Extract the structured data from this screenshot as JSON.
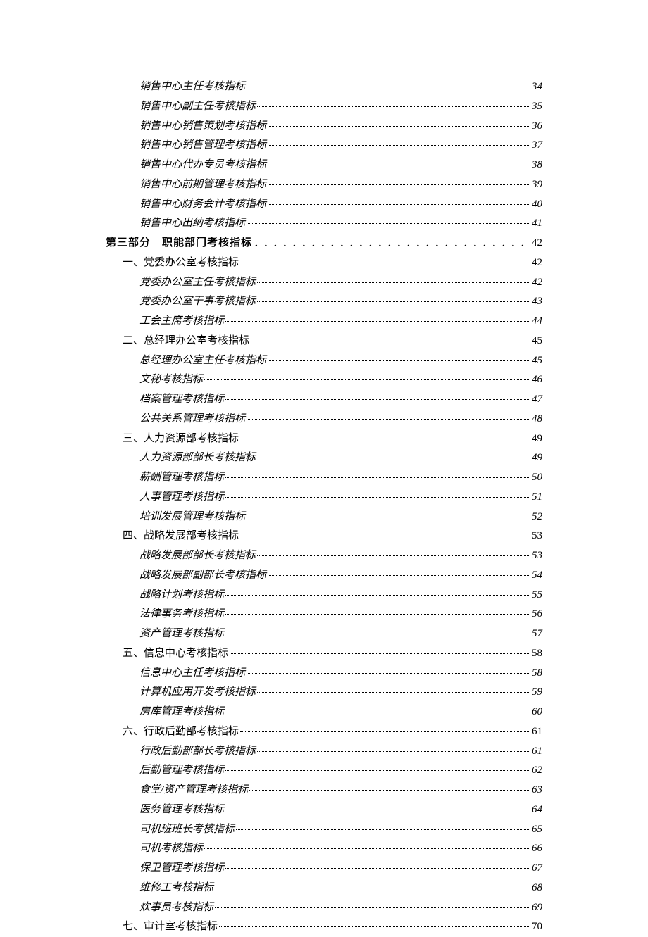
{
  "toc": [
    {
      "level": 4,
      "label": "销售中心主任考核指标",
      "page": "34"
    },
    {
      "level": 4,
      "label": "销售中心副主任考核指标",
      "page": "35"
    },
    {
      "level": 4,
      "label": "销售中心销售策划考核指标",
      "page": "36"
    },
    {
      "level": 4,
      "label": "销售中心销售管理考核指标",
      "page": "37"
    },
    {
      "level": 4,
      "label": "销售中心代办专员考核指标",
      "page": "38"
    },
    {
      "level": 4,
      "label": "销售中心前期管理考核指标",
      "page": "39"
    },
    {
      "level": 4,
      "label": "销售中心财务会计考核指标",
      "page": "40"
    },
    {
      "level": 4,
      "label": "销售中心出纳考核指标",
      "page": "41"
    },
    {
      "level": 2,
      "label": "第三部分　职能部门考核指标",
      "page": "42"
    },
    {
      "level": 3,
      "label": "一、党委办公室考核指标",
      "page": "42"
    },
    {
      "level": 4,
      "label": "党委办公室主任考核指标",
      "page": "42"
    },
    {
      "level": 4,
      "label": "党委办公室干事考核指标",
      "page": "43"
    },
    {
      "level": 4,
      "label": "工会主席考核指标",
      "page": "44"
    },
    {
      "level": 3,
      "label": "二、总经理办公室考核指标",
      "page": "45"
    },
    {
      "level": 4,
      "label": "总经理办公室主任考核指标",
      "page": "45"
    },
    {
      "level": 4,
      "label": "文秘考核指标",
      "page": "46"
    },
    {
      "level": 4,
      "label": "档案管理考核指标",
      "page": "47"
    },
    {
      "level": 4,
      "label": "公共关系管理考核指标",
      "page": "48"
    },
    {
      "level": 3,
      "label": "三、人力资源部考核指标",
      "page": "49"
    },
    {
      "level": 4,
      "label": "人力资源部部长考核指标",
      "page": "49"
    },
    {
      "level": 4,
      "label": "薪酬管理考核指标",
      "page": "50"
    },
    {
      "level": 4,
      "label": "人事管理考核指标",
      "page": "51"
    },
    {
      "level": 4,
      "label": "培训发展管理考核指标",
      "page": "52"
    },
    {
      "level": 3,
      "label": "四、战略发展部考核指标",
      "page": "53"
    },
    {
      "level": 4,
      "label": "战略发展部部长考核指标",
      "page": "53"
    },
    {
      "level": 4,
      "label": "战略发展部副部长考核指标",
      "page": "54"
    },
    {
      "level": 4,
      "label": "战略计划考核指标",
      "page": "55"
    },
    {
      "level": 4,
      "label": "法律事务考核指标",
      "page": "56"
    },
    {
      "level": 4,
      "label": "资产管理考核指标",
      "page": "57"
    },
    {
      "level": 3,
      "label": "五、信息中心考核指标",
      "page": "58"
    },
    {
      "level": 4,
      "label": "信息中心主任考核指标",
      "page": "58"
    },
    {
      "level": 4,
      "label": "计算机应用开发考核指标",
      "page": "59"
    },
    {
      "level": 4,
      "label": "房库管理考核指标",
      "page": "60"
    },
    {
      "level": 3,
      "label": "六、行政后勤部考核指标",
      "page": "61"
    },
    {
      "level": 4,
      "label": "行政后勤部部长考核指标",
      "page": "61"
    },
    {
      "level": 4,
      "label": "后勤管理考核指标",
      "page": "62"
    },
    {
      "level": 4,
      "label": "食堂/资产管理考核指标",
      "page": "63"
    },
    {
      "level": 4,
      "label": "医务管理考核指标",
      "page": "64"
    },
    {
      "level": 4,
      "label": "司机班班长考核指标",
      "page": "65"
    },
    {
      "level": 4,
      "label": "司机考核指标",
      "page": "66"
    },
    {
      "level": 4,
      "label": "保卫管理考核指标",
      "page": "67"
    },
    {
      "level": 4,
      "label": "维修工考核指标",
      "page": "68"
    },
    {
      "level": 4,
      "label": "炊事员考核指标",
      "page": "69"
    },
    {
      "level": 3,
      "label": "七、审计室考核指标",
      "page": "70"
    }
  ],
  "heavy_dots": ". . . . . . . . . . . . . . . . . . . . . . . . . . . . . . . . . . . . . . . . . . . . . ."
}
